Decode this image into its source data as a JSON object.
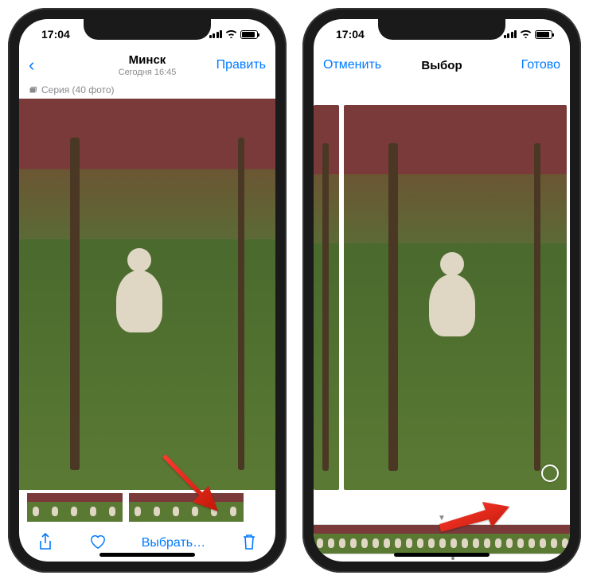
{
  "left": {
    "status": {
      "time": "17:04"
    },
    "nav": {
      "back_icon": "‹",
      "title": "Минск",
      "subtitle": "Сегодня 16:45",
      "edit": "Править"
    },
    "burst_label": "Серия (40 фото)",
    "toolbar": {
      "share_icon": "share",
      "like_icon": "heart",
      "select": "Выбрать…",
      "delete_icon": "trash"
    }
  },
  "right": {
    "status": {
      "time": "17:04"
    },
    "nav": {
      "cancel": "Отменить",
      "title": "Выбор",
      "done": "Готово"
    }
  },
  "colors": {
    "accent": "#007aff"
  }
}
